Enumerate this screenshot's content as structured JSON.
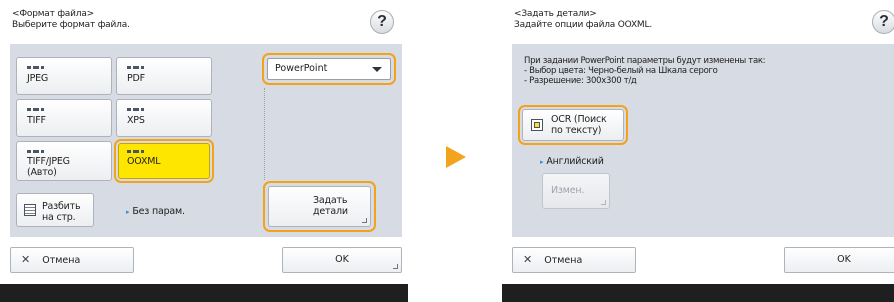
{
  "left": {
    "header": {
      "line1": "<Формат файла>",
      "line2": "Выберите формат файла."
    },
    "help_label": "?",
    "formats": [
      {
        "label": "JPEG"
      },
      {
        "label": "PDF"
      },
      {
        "label": "TIFF"
      },
      {
        "label": "XPS"
      },
      {
        "label": "TIFF/JPEG",
        "label2": "(Авто)"
      },
      {
        "label": "OOXML",
        "selected": true
      }
    ],
    "split_button": {
      "line1": "Разбить",
      "line2": "на стр."
    },
    "no_params_label": "Без парам.",
    "dropdown_value": "PowerPoint",
    "details_button": {
      "line1": "Задать",
      "line2": "детали"
    },
    "cancel_label": "Отмена",
    "ok_label": "OK"
  },
  "right": {
    "header": {
      "line1": "<Задать детали>",
      "line2": "Задайте опции файла OOXML."
    },
    "help_label": "?",
    "info": {
      "line1": "При задании PowerPoint параметры будут изменены так:",
      "line2": "- Выбор цвета: Черно-белый на Шкала серого",
      "line3": "- Разрешение: 300x300 т/д"
    },
    "ocr_button": {
      "line1": "OCR (Поиск",
      "line2": "по тексту)"
    },
    "language_label": "Английский",
    "change_button": "Измен.",
    "cancel_label": "Отмена",
    "ok_label": "OK"
  },
  "colors": {
    "accent_ring": "#f3a21a",
    "selected": "#ffe600",
    "panel": "#d7dbe3",
    "arrow": "#f4a31d"
  }
}
